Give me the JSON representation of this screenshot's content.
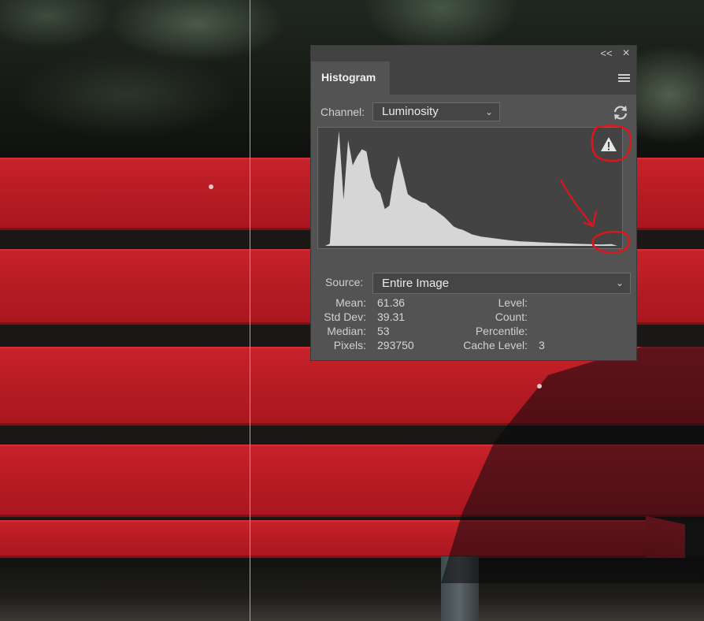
{
  "panel": {
    "title": "Histogram",
    "collapse_label": "<<",
    "close_label": "×",
    "channel_label": "Channel:",
    "channel_value": "Luminosity",
    "source_label": "Source:",
    "source_value": "Entire Image"
  },
  "stats": {
    "mean_label": "Mean:",
    "mean": "61.36",
    "std_label": "Std Dev:",
    "std": "39.31",
    "median_label": "Median:",
    "median": "53",
    "pixels_label": "Pixels:",
    "pixels": "293750",
    "level_label": "Level:",
    "count_label": "Count:",
    "percentile_label": "Percentile:",
    "cache_label": "Cache Level:",
    "cache": "3"
  },
  "icons": {
    "refresh": "refresh-icon",
    "warning": "warning-icon",
    "menu": "hamburger-menu-icon",
    "collapse": "double-chevron-left-icon",
    "close": "close-icon"
  },
  "colors": {
    "histogram_fill": "#d6d6d6",
    "annotation": "#e0141b",
    "guide": "#3fd4d0"
  },
  "chart_data": {
    "type": "area",
    "x": [
      0,
      4,
      8,
      12,
      16,
      20,
      24,
      28,
      32,
      36,
      40,
      44,
      48,
      52,
      56,
      60,
      64,
      68,
      72,
      76,
      80,
      84,
      88,
      92,
      96,
      100,
      104,
      108,
      112,
      116,
      120,
      124,
      128,
      136,
      144,
      152,
      160,
      170,
      180,
      190,
      200,
      210,
      220,
      230,
      240,
      250,
      255
    ],
    "values": [
      0,
      2,
      60,
      100,
      40,
      92,
      70,
      78,
      84,
      82,
      60,
      50,
      46,
      32,
      35,
      60,
      78,
      62,
      45,
      42,
      40,
      38,
      37,
      33,
      31,
      28,
      25,
      21,
      17,
      15,
      14,
      12,
      10,
      8,
      7,
      6,
      5,
      4,
      3.5,
      3,
      2.5,
      2.2,
      1.8,
      1.5,
      1.2,
      1.5,
      0
    ],
    "ylim": [
      0,
      100
    ],
    "xlim": [
      0,
      255
    ]
  }
}
